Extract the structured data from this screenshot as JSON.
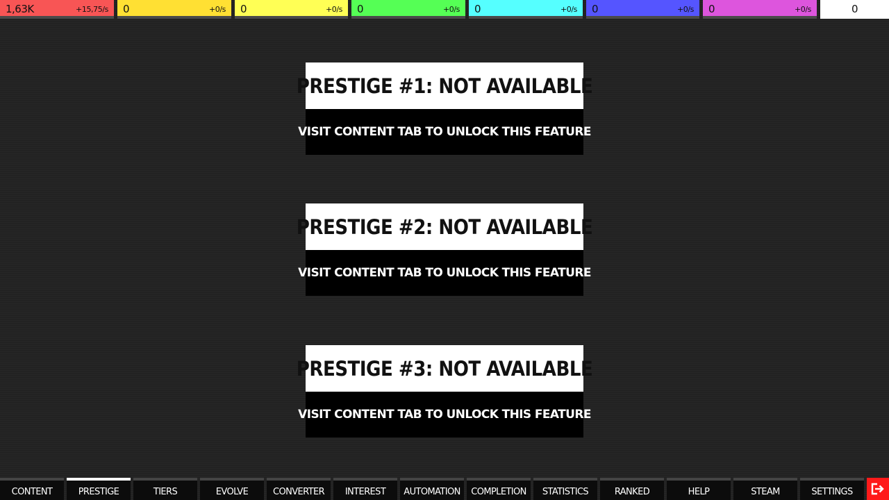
{
  "resources": [
    {
      "amount": "1,63K",
      "rate": "+15,75/s",
      "color": "#f85555"
    },
    {
      "amount": "0",
      "rate": "+0/s",
      "color": "#ffe033"
    },
    {
      "amount": "0",
      "rate": "+0/s",
      "color": "#ffff55"
    },
    {
      "amount": "0",
      "rate": "+0/s",
      "color": "#55ff55"
    },
    {
      "amount": "0",
      "rate": "+0/s",
      "color": "#55ffff"
    },
    {
      "amount": "0",
      "rate": "+0/s",
      "color": "#5555ff"
    },
    {
      "amount": "0",
      "rate": "+0/s",
      "color": "#dd55dd"
    }
  ],
  "extra_resource": {
    "amount": "0",
    "color": "#ffffff"
  },
  "prestige": [
    {
      "title": "PRESTIGE #1: NOT AVAILABLE",
      "hint": "VISIT CONTENT TAB TO UNLOCK THIS FEATURE"
    },
    {
      "title": "PRESTIGE #2: NOT AVAILABLE",
      "hint": "VISIT CONTENT TAB TO UNLOCK THIS FEATURE"
    },
    {
      "title": "PRESTIGE #3: NOT AVAILABLE",
      "hint": "VISIT CONTENT TAB TO UNLOCK THIS FEATURE"
    }
  ],
  "nav": {
    "active": "PRESTIGE",
    "tabs": [
      "CONTENT",
      "PRESTIGE",
      "TIERS",
      "EVOLVE",
      "CONVERTER",
      "INTEREST",
      "AUTOMATION",
      "COMPLETION",
      "STATISTICS",
      "RANKED",
      "HELP",
      "STEAM",
      "SETTINGS"
    ],
    "exit_icon": "exit-icon",
    "exit_color": "#ff1a1a"
  }
}
